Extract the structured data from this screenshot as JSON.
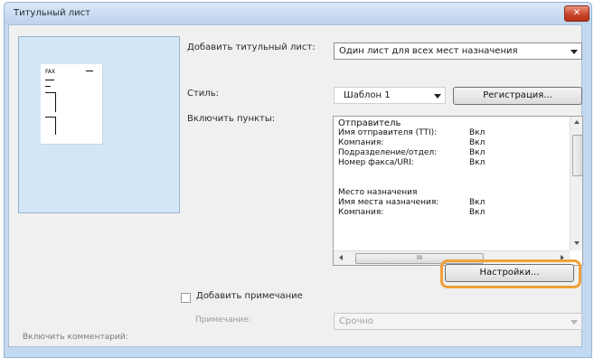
{
  "window": {
    "title": "Титульный лист",
    "close_glyph": "✕"
  },
  "preview": {
    "fax_label": "FAX"
  },
  "add_cover": {
    "label": "Добавить титульный лист:",
    "value": "Один лист для всех мест назначения"
  },
  "style": {
    "label": "Стиль:",
    "value": "Шаблон 1",
    "register_label": "Регистрация..."
  },
  "include": {
    "label": "Включить пункты:",
    "rows": [
      {
        "name": "Отправитель",
        "value": ""
      },
      {
        "name": "Имя отправителя (TTI):",
        "value": "Вкл"
      },
      {
        "name": "Компания:",
        "value": "Вкл"
      },
      {
        "name": "Подразделение/отдел:",
        "value": "Вкл"
      },
      {
        "name": "Номер факса/URI:",
        "value": "Вкл"
      },
      {
        "name": "",
        "value": ""
      },
      {
        "name": "Место назначения",
        "value": ""
      },
      {
        "name": "Имя места назначения:",
        "value": "Вкл"
      },
      {
        "name": "Компания:",
        "value": "Вкл"
      }
    ],
    "hscroll_grip": "III"
  },
  "settings_label": "Настройки...",
  "notes": {
    "checkbox_label": "Добавить примечание",
    "note_label": "Примечание:",
    "note_value": "Срочно"
  },
  "comment_label": "Включить комментарий:"
}
